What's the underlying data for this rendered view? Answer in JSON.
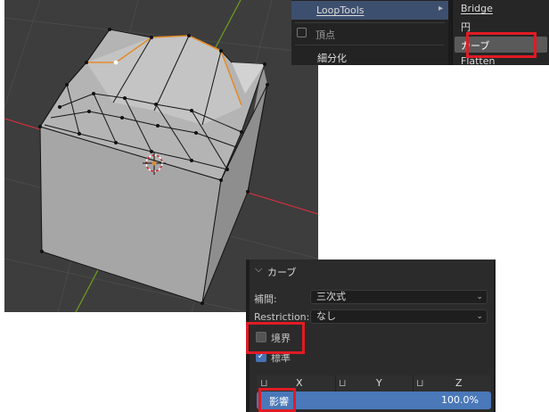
{
  "menu": {
    "loop_tools_label": "LoopTools",
    "loop_tools_arrow": "▸",
    "vertex_label": "頂点",
    "subdivide_label": "細分化",
    "vertex_icon": "vertex-icon"
  },
  "submenu": {
    "items": [
      "Bridge",
      "円",
      "カーブ",
      "Flatten"
    ],
    "selected_index": 2
  },
  "operator_panel": {
    "header": "カーブ",
    "header_chevron": "⌵",
    "interpolation_label": "補間:",
    "interpolation_value": "三次式",
    "restriction_label": "Restriction:",
    "restriction_value": "なし",
    "boundaries_label": "境界",
    "boundaries_checked": false,
    "regular_label": "標準",
    "regular_checked": true,
    "check_mark": "✓",
    "lock_glyph": "⊔",
    "axes": [
      "X",
      "Y",
      "Z"
    ],
    "influence_label": "影響",
    "influence_value": "100.0%"
  },
  "colors": {
    "viewport_bg": "#3d3d3d",
    "mesh_face": "#a9a9a9",
    "selected_edge": "#e38b2c",
    "x_axis": "#c8313e",
    "y_axis": "#6c9a1e",
    "highlight_red": "#e01b24",
    "influence_blue": "#4a78b8"
  }
}
